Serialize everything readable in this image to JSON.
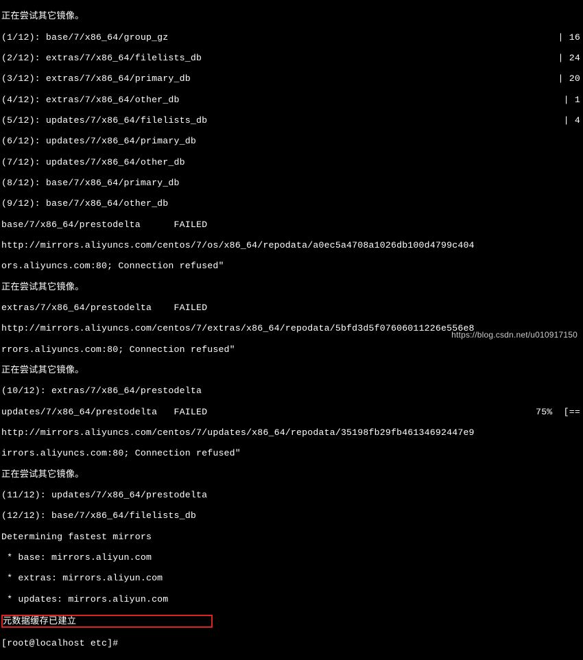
{
  "terminal": {
    "retry_msg": "正在尝试其它镜像。",
    "progress": [
      {
        "left": "(1/12): base/7/x86_64/group_gz",
        "right": "| 16"
      },
      {
        "left": "(2/12): extras/7/x86_64/filelists_db",
        "right": "| 24"
      },
      {
        "left": "(3/12): extras/7/x86_64/primary_db",
        "right": "| 20"
      },
      {
        "left": "(4/12): extras/7/x86_64/other_db",
        "right": "| 1"
      },
      {
        "left": "(5/12): updates/7/x86_64/filelists_db",
        "right": "| 4"
      },
      {
        "left": "(6/12): updates/7/x86_64/primary_db",
        "right": ""
      },
      {
        "left": "(7/12): updates/7/x86_64/other_db",
        "right": ""
      },
      {
        "left": "(8/12): base/7/x86_64/primary_db",
        "right": ""
      },
      {
        "left": "(9/12): base/7/x86_64/other_db",
        "right": ""
      }
    ],
    "fail1_label": "base/7/x86_64/prestodelta      FAILED",
    "fail1_url": "http://mirrors.aliyuncs.com/centos/7/os/x86_64/repodata/a0ec5a4708a1026db100d4799c404",
    "fail1_err": "ors.aliyuncs.com:80; Connection refused\"",
    "fail2_label": "extras/7/x86_64/prestodelta    FAILED",
    "fail2_url": "http://mirrors.aliyuncs.com/centos/7/extras/x86_64/repodata/5bfd3d5f07606011226e556e8",
    "fail2_err": "rrors.aliyuncs.com:80; Connection refused\"",
    "step10": "(10/12): extras/7/x86_64/prestodelta",
    "fail3_left": "updates/7/x86_64/prestodelta   FAILED",
    "fail3_right": "75%  [==",
    "fail3_url": "http://mirrors.aliyuncs.com/centos/7/updates/x86_64/repodata/35198fb29fb46134692447e9",
    "fail3_err": "irrors.aliyuncs.com:80; Connection refused\"",
    "step11": "(11/12): updates/7/x86_64/prestodelta",
    "step12": "(12/12): base/7/x86_64/filelists_db",
    "determining": "Determining fastest mirrors",
    "mirror_base": " * base: mirrors.aliyun.com",
    "mirror_extras": " * extras: mirrors.aliyun.com",
    "mirror_updates": " * updates: mirrors.aliyun.com",
    "cache_built": "元数据缓存已建立",
    "prompt": "[root@localhost etc]#"
  },
  "watermark": "https://blog.csdn.net/u010917150"
}
